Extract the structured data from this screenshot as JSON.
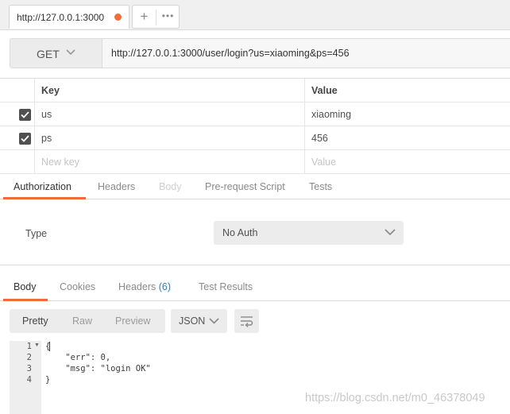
{
  "tab": {
    "title": "http://127.0.0.1:3000",
    "add_label": "+",
    "more_label": "•••"
  },
  "request": {
    "method": "GET",
    "url": "http://127.0.0.1:3000/user/login?us=xiaoming&ps=456"
  },
  "params": {
    "headers": {
      "key": "Key",
      "value": "Value"
    },
    "rows": [
      {
        "key": "us",
        "value": "xiaoming",
        "checked": true
      },
      {
        "key": "ps",
        "value": "456",
        "checked": true
      }
    ],
    "new_key_placeholder": "New key",
    "new_value_placeholder": "Value"
  },
  "request_tabs": [
    "Authorization",
    "Headers",
    "Body",
    "Pre-request Script",
    "Tests"
  ],
  "auth": {
    "type_label": "Type",
    "selected": "No Auth"
  },
  "response_tabs": {
    "body": "Body",
    "cookies": "Cookies",
    "headers": "Headers",
    "headers_count": "(6)",
    "test_results": "Test Results"
  },
  "view_modes": [
    "Pretty",
    "Raw",
    "Preview"
  ],
  "format": "JSON",
  "code": {
    "line_numbers": [
      "1",
      "2",
      "3",
      "4"
    ],
    "lines": [
      "{",
      "    \"err\": 0,",
      "    \"msg\": \"login OK\"",
      "}"
    ]
  },
  "watermark": "https://blog.csdn.net/m0_46378049",
  "colors": {
    "accent": "#f26b3a",
    "link": "#1a84d8"
  },
  "icons": {
    "unsaved": "orange-dot-icon",
    "method_dropdown": "chevron-down-icon",
    "auth_dropdown": "chevron-down-icon",
    "format_dropdown": "chevron-down-icon",
    "wrap": "wrap-lines-icon",
    "checkbox": "checkmark-icon",
    "fold": "fold-arrow-icon"
  }
}
